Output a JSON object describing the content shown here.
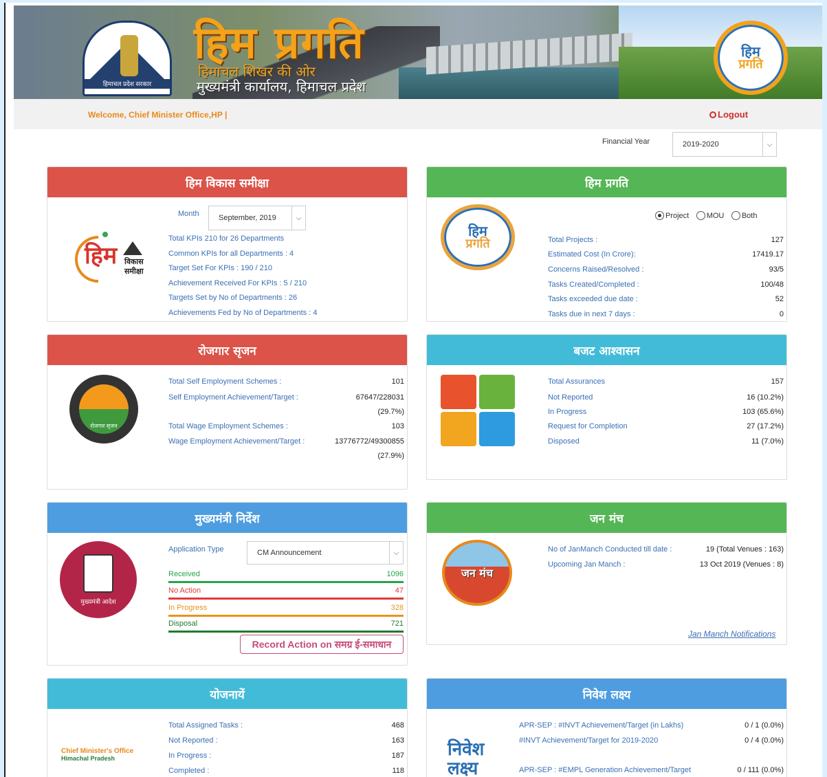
{
  "banner": {
    "title": "हिम प्रगति",
    "subtitle1": "हिमाचल शिखर की ओर",
    "subtitle2": "मुख्यमंत्री कार्यालय, हिमाचल प्रदेश",
    "emblem_text": "हिमाचल प्रदेश सरकार",
    "logo_line1": "हिम",
    "logo_line2": "प्रगति"
  },
  "welcome": {
    "text": "Welcome, Chief Minister Office,HP |",
    "logout": "Logout"
  },
  "financial_year": {
    "label": "Financial Year",
    "value": "2019-2020"
  },
  "him_vikas": {
    "title": "हिम विकास समीक्षा",
    "month_label": "Month",
    "month_value": "September, 2019",
    "logo_main": "हिम",
    "logo_side1": "विकास",
    "logo_side2": "समीक्षा",
    "lines": [
      "Total KPIs 210 for 26 Departments",
      "Common KPIs for all Departments : 4",
      "Target Set For KPIs :  190 / 210",
      "Achievement Received For KPIs :  5 / 210",
      "Targets Set by No of Departments :  26",
      "Achievements Fed by No of Departments :  4"
    ]
  },
  "him_pragati": {
    "title": "हिम प्रगति",
    "radios": [
      "Project",
      "MOU",
      "Both"
    ],
    "rows": [
      {
        "label": "Total Projects :",
        "value": "127"
      },
      {
        "label": "Estimated Cost (In Crore):",
        "value": "17419.17"
      },
      {
        "label": "Concerns Raised/Resolved :",
        "value": "93/5"
      },
      {
        "label": "Tasks Created/Completed :",
        "value": "100/48"
      },
      {
        "label": "Tasks exceeded due date :",
        "value": "52"
      },
      {
        "label": "Tasks due in next 7 days :",
        "value": "0"
      }
    ]
  },
  "rozgar": {
    "title": "रोजगार सृजन",
    "logo_text": "रोजगार सृजन",
    "rows": [
      {
        "label": "Total Self Employment Schemes :",
        "value": "101"
      },
      {
        "label": "Self Employment Achievement/Target :",
        "value": "67647/228031"
      },
      {
        "label": "",
        "value": "(29.7%)"
      },
      {
        "label": "Total Wage Employment Schemes :",
        "value": "103"
      },
      {
        "label": "Wage Employment Achievement/Target :",
        "value": "13776772/49300855"
      },
      {
        "label": "",
        "value": "(27.9%)"
      }
    ]
  },
  "budget": {
    "title": "बजट आश्वासन",
    "rows": [
      {
        "label": "Total Assurances",
        "value": "157"
      },
      {
        "label": "Not Reported",
        "value": "16 (10.2%)"
      },
      {
        "label": "In Progress",
        "value": "103 (65.6%)"
      },
      {
        "label": "Request for Completion",
        "value": "27 (17.2%)"
      },
      {
        "label": "Disposed",
        "value": "11 (7.0%)"
      }
    ]
  },
  "cm_nirdesh": {
    "title": "मुख्यमंत्री निर्देश",
    "logo_text": "मुख्यमंत्री आदेश",
    "app_type_label": "Application Type",
    "app_type_value": "CM Announcement",
    "rows": [
      {
        "label": "Received",
        "value": "1096"
      },
      {
        "label": "No Action",
        "value": "47"
      },
      {
        "label": "In Progress",
        "value": "328"
      },
      {
        "label": "Disposal",
        "value": "721"
      }
    ],
    "colors": [
      "#27a348",
      "#e03a3a",
      "#e8931c",
      "#1f7a2e"
    ],
    "record_button": "Record Action on समग्र ई-समाधान"
  },
  "jan_manch": {
    "title": "जन मंच",
    "logo_text": "जन मंच",
    "rows": [
      {
        "label": "No of JanManch Conducted till date :",
        "value": "19 (Total Venues : 163)"
      },
      {
        "label": "Upcoming Jan Manch :",
        "value": "13 Oct 2019 (Venues : 8)"
      }
    ],
    "link": "Jan Manch Notifications"
  },
  "yojnaye": {
    "title": "योजनायें",
    "logo_line1": "Chief Minister's Office",
    "logo_line2": "Himachal Pradesh",
    "rows": [
      {
        "label": "Total Assigned Tasks :",
        "value": "468"
      },
      {
        "label": "Not Reported :",
        "value": "163"
      },
      {
        "label": "In Progress :",
        "value": "187"
      },
      {
        "label": "Completed :",
        "value": "118"
      }
    ]
  },
  "nivesh": {
    "title": "निवेश लक्ष्य",
    "logo_line1": "निवेश",
    "logo_line2": "लक्ष्य",
    "rows": [
      {
        "label": "APR-SEP : #INVT Achievement/Target (in Lakhs)",
        "value": "0 / 1 (0.0%)"
      },
      {
        "label": "#INVT Achievement/Target for 2019-2020",
        "value": "0 / 4 (0.0%)"
      },
      {
        "label": "APR-SEP : #EMPL Generation Achievement/Target",
        "value": "0 / 111 (0.0%)"
      }
    ]
  }
}
